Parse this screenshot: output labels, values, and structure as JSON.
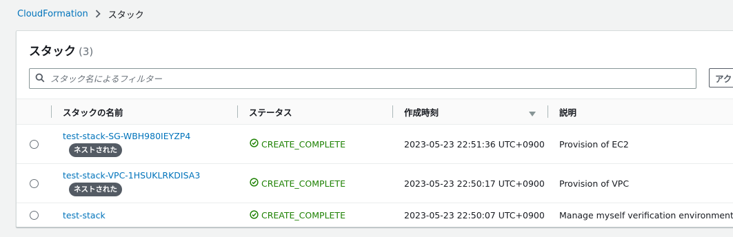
{
  "breadcrumb": {
    "root": "CloudFormation",
    "current": "スタック"
  },
  "panel": {
    "title": "スタック",
    "count": "(3)"
  },
  "filter": {
    "placeholder": "スタック名によるフィルター",
    "icon": "search-icon"
  },
  "actions_button": {
    "label": "アク"
  },
  "table": {
    "columns": {
      "name": "スタックの名前",
      "status": "ステータス",
      "created": "作成時刻",
      "description": "説明"
    },
    "rows": [
      {
        "name": "test-stack-SG-WBH980IEYZP4",
        "badge": "ネストされた",
        "status": "CREATE_COMPLETE",
        "created": "2023-05-23 22:51:36 UTC+0900",
        "description": "Provision of EC2"
      },
      {
        "name": "test-stack-VPC-1HSUKLRKDISA3",
        "badge": "ネストされた",
        "status": "CREATE_COMPLETE",
        "created": "2023-05-23 22:50:17 UTC+0900",
        "description": "Provision of VPC"
      },
      {
        "name": "test-stack",
        "badge": null,
        "status": "CREATE_COMPLETE",
        "created": "2023-05-23 22:50:07 UTC+0900",
        "description": "Manage myself verification environment"
      }
    ]
  },
  "colors": {
    "link": "#0073bb",
    "success": "#1d8102",
    "badge_bg": "#545b64"
  }
}
